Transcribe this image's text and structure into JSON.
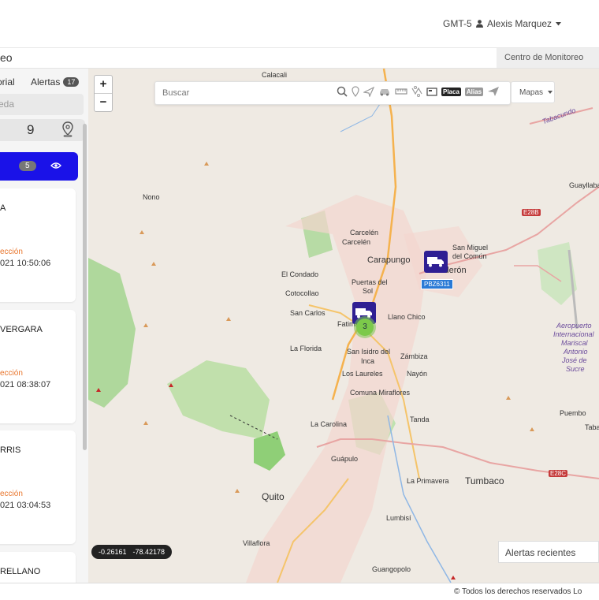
{
  "header": {
    "timezone": "GMT-5",
    "user_name": "Alexis Marquez"
  },
  "subheader": {
    "title": "eo",
    "breadcrumb": "Centro de Monitoreo"
  },
  "sidebar": {
    "tabs": {
      "history": "orial",
      "alerts": "Alertas",
      "alerts_count": "17"
    },
    "search_placeholder": "eda",
    "vehicle_count": "9",
    "group": {
      "count": "5"
    },
    "cards": [
      {
        "name": "A",
        "direction_label": "ección",
        "date": "021 10:50:06"
      },
      {
        "name": "VERGARA",
        "direction_label": "ección",
        "date": "021 08:38:07"
      },
      {
        "name": "RRIS",
        "direction_label": "ección",
        "date": "021 03:04:53"
      },
      {
        "name": "RELLANO",
        "direction_label": "",
        "date": ""
      }
    ]
  },
  "map": {
    "search_placeholder": "Buscar",
    "tag_placa": "Placa",
    "tag_alias": "Alias",
    "layers_button": "Mapas",
    "zoom_in": "+",
    "zoom_out": "−",
    "coords": {
      "lat": "-0.26161",
      "lon": "-78.42178"
    },
    "recent_alerts": "Alertas recientes",
    "vehicle_plate": "PBZ6311",
    "cluster_count": "3",
    "labels": {
      "calacali": "Calacali",
      "tabacundo": "Tabacundo",
      "guayllabamba": "Guayllaba",
      "nono": "Nono",
      "e28b": "E28B",
      "carcelen1": "Carcelén",
      "carcelen2": "Carcelén",
      "carapungo": "Carapungo",
      "calderon": "Calderón",
      "san_miguel": "San Miguel",
      "del_comun": "del Común",
      "el_condado": "El Condado",
      "puertas": "Puertas del",
      "sol": "Sol",
      "cotocollao": "Cotocollao",
      "san_carlos": "San Carlos",
      "fatima": "Fatima",
      "llano_chico": "Llano Chico",
      "aeropuerto1": "Aeropuerto",
      "aeropuerto2": "Internacional",
      "aeropuerto3": "Mariscal",
      "aeropuerto4": "Antonio",
      "aeropuerto5": "José de",
      "aeropuerto6": "Sucre",
      "la_florida": "La Florida",
      "san_isidro": "San Isidro del",
      "inca": "Inca",
      "zambiza": "Zámbiza",
      "los_laureles": "Los Laureles",
      "nayon": "Nayón",
      "miraflores": "Comuna Miraflores",
      "tanda": "Tanda",
      "puembo": "Puembo",
      "la_carolina": "La Carolina",
      "taba": "Taba",
      "guapulo": "Guápulo",
      "la_primavera": "La Primavera",
      "tumbaco": "Tumbaco",
      "e28c": "E28C",
      "quito": "Quito",
      "lumbisi": "Lumbisí",
      "villaflora": "Villaflora",
      "guangopolo": "Guangopolo"
    }
  },
  "footer": {
    "copyright": "© Todos los derechos reservados Lo"
  },
  "colors": {
    "accent_blue": "#1a12e8",
    "vehicle_marker": "#2f1f93",
    "direction_orange": "#e8742a",
    "map_base": "#efeae3"
  }
}
